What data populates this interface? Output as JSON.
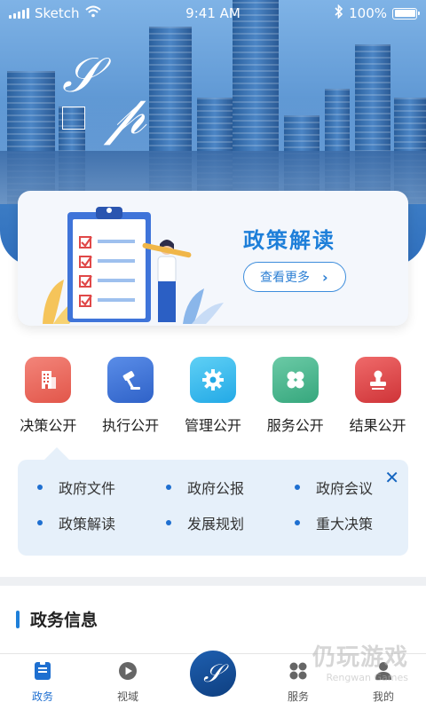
{
  "status_bar": {
    "carrier": "Sketch",
    "time": "9:41 AM",
    "battery": "100%"
  },
  "banner": {
    "title": "政策解读",
    "more_label": "查看更多",
    "more_chevron": "›"
  },
  "categories": [
    {
      "label": "决策公开",
      "icon": "building-icon",
      "color": "#ef6b5b"
    },
    {
      "label": "执行公开",
      "icon": "gavel-icon",
      "color": "#3f74d9"
    },
    {
      "label": "管理公开",
      "icon": "gear-icon",
      "color": "#33b4ea"
    },
    {
      "label": "服务公开",
      "icon": "clover-icon",
      "color": "#43b88e"
    },
    {
      "label": "结果公开",
      "icon": "stamp-icon",
      "color": "#e0464a"
    }
  ],
  "links": [
    "政府文件",
    "政府公报",
    "政府会议",
    "政策解读",
    "发展规划",
    "重大决策"
  ],
  "section": {
    "title": "政务信息"
  },
  "tabs": [
    {
      "label": "政务",
      "icon": "document-icon",
      "active": true
    },
    {
      "label": "视域",
      "icon": "play-icon",
      "active": false
    },
    {
      "label": "",
      "icon": "app-logo",
      "active": false
    },
    {
      "label": "服务",
      "icon": "grid-icon",
      "active": false
    },
    {
      "label": "我的",
      "icon": "user-icon",
      "active": false
    }
  ],
  "watermark": {
    "title": "仍玩游戏",
    "subtitle": "Rengwan Games"
  },
  "colors": {
    "accent": "#1e7fd9",
    "link_panel": "#e6f0fa"
  }
}
